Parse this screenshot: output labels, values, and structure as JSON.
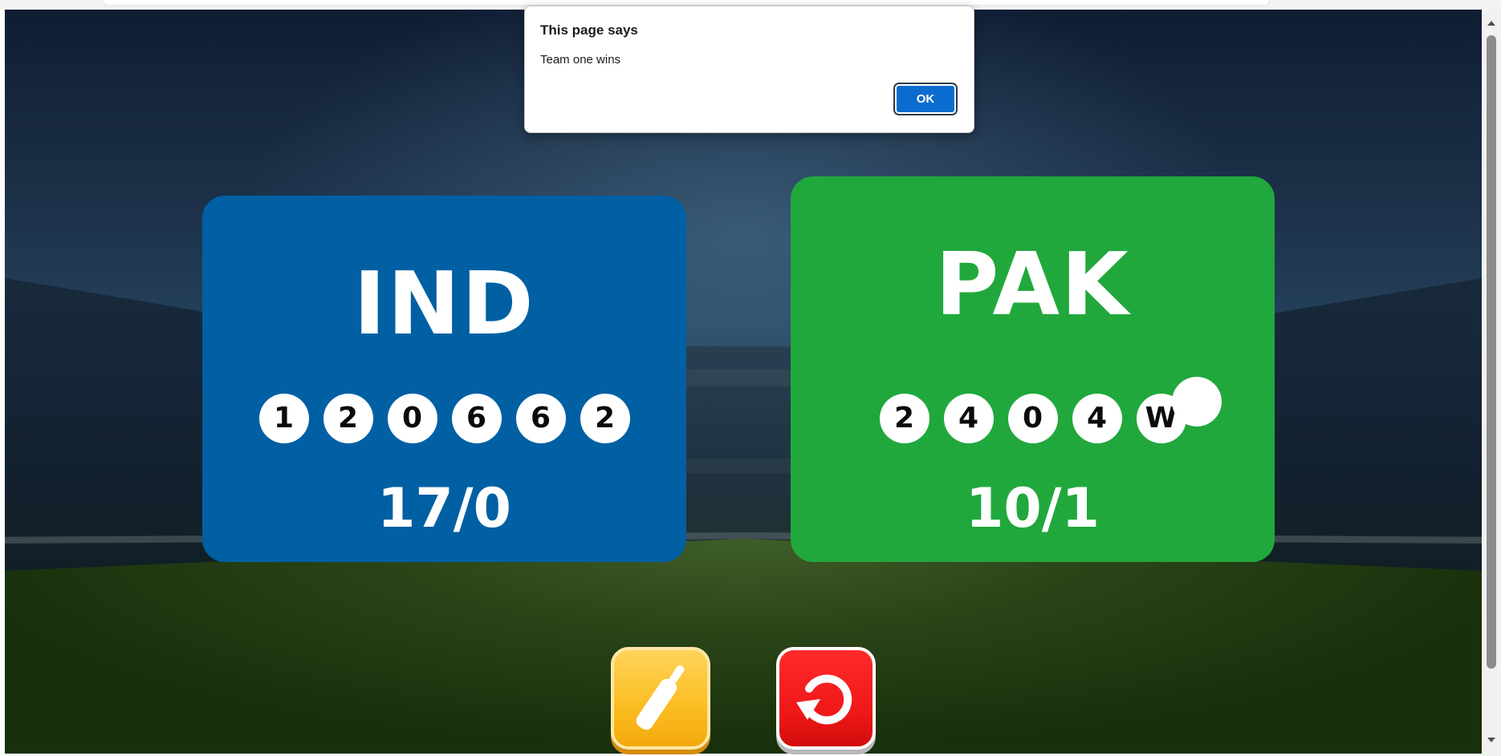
{
  "dialog": {
    "title": "This page says",
    "message": "Team one wins",
    "ok_label": "OK"
  },
  "team_one": {
    "name": "IND",
    "balls": [
      "1",
      "2",
      "0",
      "6",
      "6",
      "2"
    ],
    "score": "17/0",
    "color": "#0060a3"
  },
  "team_two": {
    "name": "PAK",
    "balls": [
      "2",
      "4",
      "0",
      "4",
      "W"
    ],
    "score": "10/1",
    "color": "#21a83d"
  },
  "controls": {
    "hit_icon": "cricket-bat-icon",
    "reset_icon": "reset-icon",
    "hit_color": "#fbbd21",
    "reset_color": "#ef1818"
  }
}
